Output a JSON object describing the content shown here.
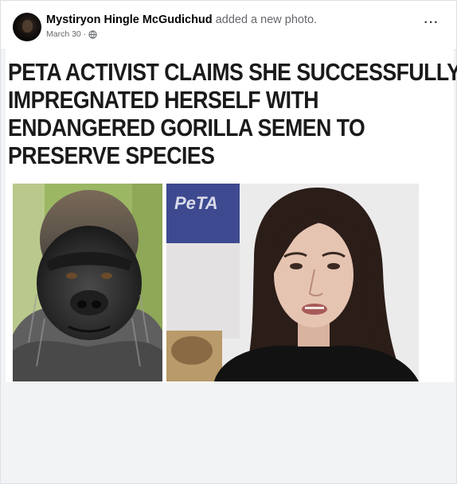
{
  "post": {
    "author": "Mystiryon Hingle McGudichud",
    "action": "added a new photo.",
    "date": "March 30",
    "separator": "·",
    "privacy_icon": "globe-icon",
    "more_icon": "ellipsis-icon",
    "more_label": "···"
  },
  "meme": {
    "headline_lines": [
      "PETA ACTIVIST CLAIMS SHE SUCCESSFULLY",
      "IMPREGNATED HERSELF WITH",
      "ENDANGERED GORILLA SEMEN TO",
      "PRESERVE SPECIES"
    ],
    "logo_text": "PeTA"
  },
  "colors": {
    "name_text": "#050505",
    "secondary_text": "#65676b",
    "photo_background": "#f2f3f5",
    "peta_banner": "#3d4a8f"
  }
}
